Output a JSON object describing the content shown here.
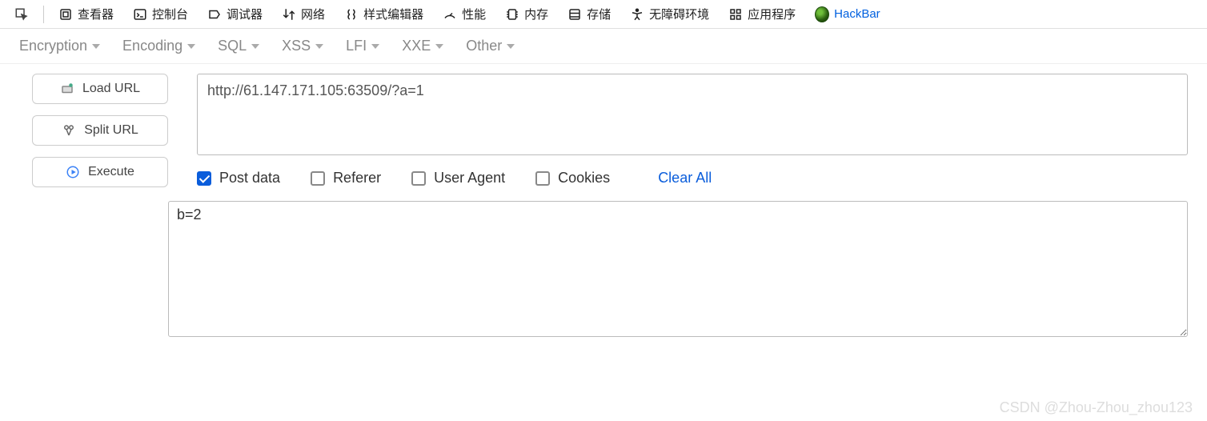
{
  "devtools": {
    "tabs": {
      "inspector": "查看器",
      "console": "控制台",
      "debugger": "调试器",
      "network": "网络",
      "style_editor": "样式编辑器",
      "performance": "性能",
      "memory": "内存",
      "storage": "存储",
      "accessibility": "无障碍环境",
      "application": "应用程序",
      "hackbar": "HackBar"
    }
  },
  "hackbar": {
    "menu": {
      "encryption": "Encryption",
      "encoding": "Encoding",
      "sql": "SQL",
      "xss": "XSS",
      "lfi": "LFI",
      "xxe": "XXE",
      "other": "Other"
    },
    "buttons": {
      "load_url": "Load URL",
      "split_url": "Split URL",
      "execute": "Execute"
    },
    "url_value": "http://61.147.171.105:63509/?a=1",
    "options": {
      "post_data": "Post data",
      "referer": "Referer",
      "user_agent": "User Agent",
      "cookies": "Cookies",
      "clear_all": "Clear All",
      "post_data_checked": true,
      "referer_checked": false,
      "user_agent_checked": false,
      "cookies_checked": false
    },
    "post_value": "b=2"
  },
  "watermark": "CSDN @Zhou-Zhou_zhou123"
}
